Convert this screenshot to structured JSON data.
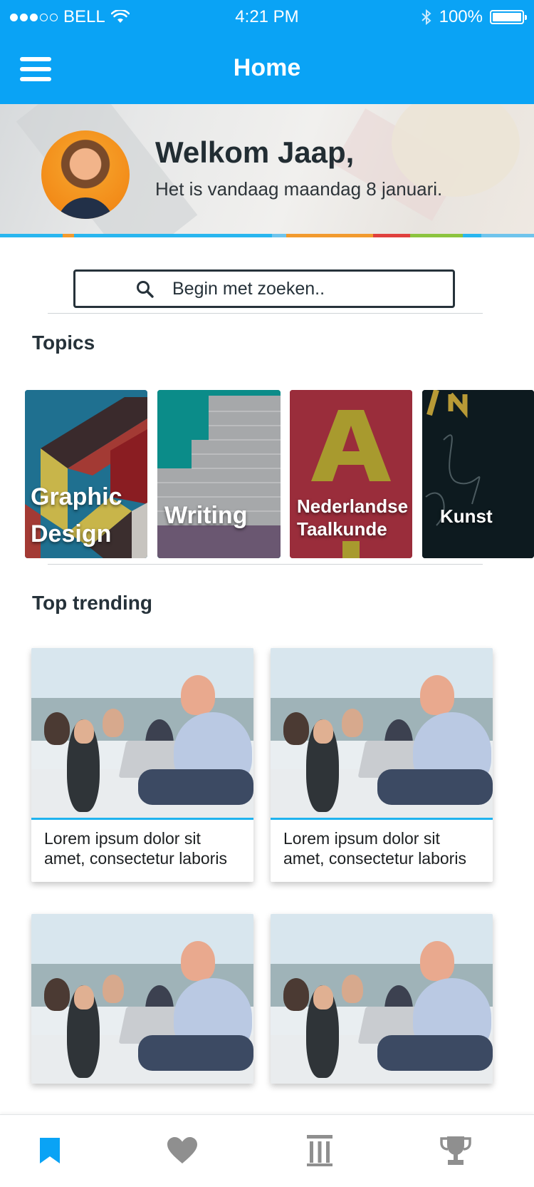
{
  "status_bar": {
    "carrier": "BELL",
    "time": "4:21 PM",
    "battery": "100%"
  },
  "header": {
    "title": "Home"
  },
  "banner": {
    "welcome": "Welkom Jaap,",
    "date_text": "Het is vandaag maandag 8 januari."
  },
  "search": {
    "placeholder": "Begin met zoeken.."
  },
  "topics": {
    "heading": "Topics",
    "items": [
      {
        "label_line1": "Graphic",
        "label_line2": "Design"
      },
      {
        "label_line1": "Writing"
      },
      {
        "label_line1": "Nederlandse",
        "label_line2": "Taalkunde"
      },
      {
        "label_line1": "Kunst"
      }
    ]
  },
  "trending": {
    "heading": "Top trending",
    "cards": [
      {
        "line1": "Lorem ipsum dolor sit",
        "line2": "amet, consectetur laboris"
      },
      {
        "line1": "Lorem ipsum dolor sit",
        "line2": "amet, consectetur laboris"
      },
      {
        "line1": "",
        "line2": ""
      },
      {
        "line1": "",
        "line2": ""
      }
    ]
  },
  "tabbar": {
    "items": [
      {
        "icon": "bookmark-icon",
        "active": true
      },
      {
        "icon": "heart-icon",
        "active": false
      },
      {
        "icon": "library-icon",
        "active": false
      },
      {
        "icon": "trophy-icon",
        "active": false
      }
    ],
    "active_color": "#0aa3f5",
    "inactive_color": "#8f8f8f"
  },
  "colors": {
    "accent": "#0aa3f5",
    "text": "#26323a"
  }
}
